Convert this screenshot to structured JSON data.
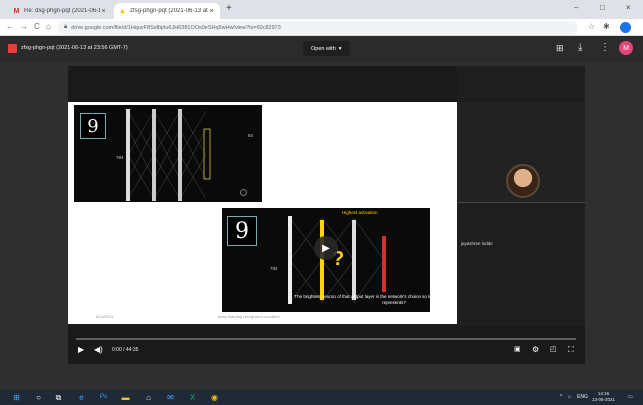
{
  "browser": {
    "tabs": [
      {
        "title": "Re: dsg-phgn-pqt (2021-06-13 at 23:56 GMT-7) - ...",
        "icon": "gmail-icon",
        "active": false
      },
      {
        "title": "zfsg-phgn-pqt (2021-06-13 at 23:56 GMT-7)",
        "icon": "drive-icon",
        "active": true
      }
    ],
    "new_tab": "+",
    "window_controls": [
      "–",
      "□",
      "×"
    ],
    "url": "drive.google.com/file/d/1HquvF8Ssfbjdu6JH6381OOs0eSHq5wHw/view?ts=60c82973",
    "accent": "#1a73e8"
  },
  "viewer": {
    "file_name": "zfsg-phgn-pqt (2021-06-13 at 23:56 GMT-7)",
    "open_with": "Open with",
    "header_icons": [
      "add-comment-icon",
      "download-icon",
      "more-vert-icon"
    ],
    "account_initial": "M",
    "account_color": "#e8437c"
  },
  "video": {
    "slide": {
      "top_digit": "9",
      "top_input_label": "784",
      "top_output_label": "84",
      "bottom_digit": "9",
      "bottom_input_label": "784",
      "highlight_text": "Highest activation",
      "question": "?",
      "caption": "The brightest neuron of that output layer is the network's choice so to speak for what digit this image represents?",
      "footer_left": "6/14/2021",
      "footer_mid": "deep learning recognized numbers"
    },
    "participant_name": "jayashree lodde",
    "current_time": "0:00",
    "duration": "44:35",
    "time_display": "0:00 / 44:35",
    "progress": 0.0,
    "control_icons": [
      "play-icon",
      "volume-icon",
      "captions-icon",
      "settings-icon",
      "miniplayer-icon",
      "fullscreen-icon"
    ]
  },
  "taskbar": {
    "apps": [
      "windows-start-icon",
      "search-icon",
      "task-view-icon",
      "edge-icon",
      "photoshop-icon",
      "file-explorer-icon",
      "store-icon",
      "mail-icon",
      "excel-icon",
      "chrome-icon"
    ],
    "language": "ENG",
    "time": "14:16",
    "date": "13-06-2021"
  }
}
